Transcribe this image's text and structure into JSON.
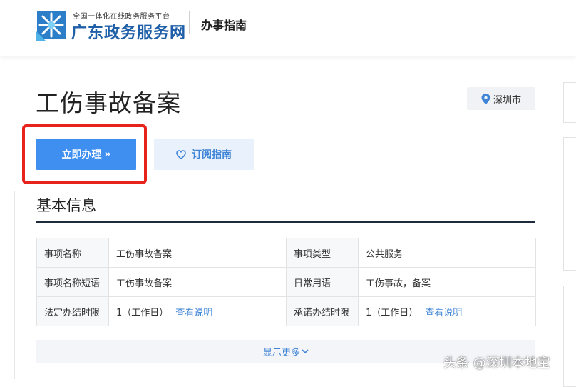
{
  "header": {
    "logo_subtitle": "全国一体化在线政务服务平台",
    "logo_title": "广东政务服务网",
    "nav_item": "办事指南"
  },
  "page": {
    "title": "工伤事故备案",
    "location": "深圳市"
  },
  "actions": {
    "handle_label": "立即办理",
    "handle_arrow": "»",
    "subscribe_label": "订阅指南"
  },
  "section": {
    "title": "基本信息"
  },
  "info": {
    "rows": [
      {
        "label1": "事项名称",
        "value1": "工伤事故备案",
        "label2": "事项类型",
        "value2": "公共服务"
      },
      {
        "label1": "事项名称短语",
        "value1": "工伤事故备案",
        "label2": "日常用语",
        "value2": "工伤事故，备案"
      },
      {
        "label1": "法定办结时限",
        "value1": "1（工作日）",
        "link1": "查看说明",
        "label2": "承诺办结时限",
        "value2": "1（工作日）",
        "link2": "查看说明"
      }
    ]
  },
  "more": {
    "label": "显示更多"
  },
  "watermark": "头条 @深圳本地宝",
  "colors": {
    "primary": "#3f8ff0",
    "link": "#3f84d6",
    "highlight": "#e8231c",
    "logo": "#1f5fa8",
    "rule": "#1d2b3a"
  },
  "icons": {
    "logo": "snowflake-logo-icon",
    "location": "map-pin-icon",
    "subscribe": "heart-icon",
    "more": "chevron-down-icon"
  }
}
